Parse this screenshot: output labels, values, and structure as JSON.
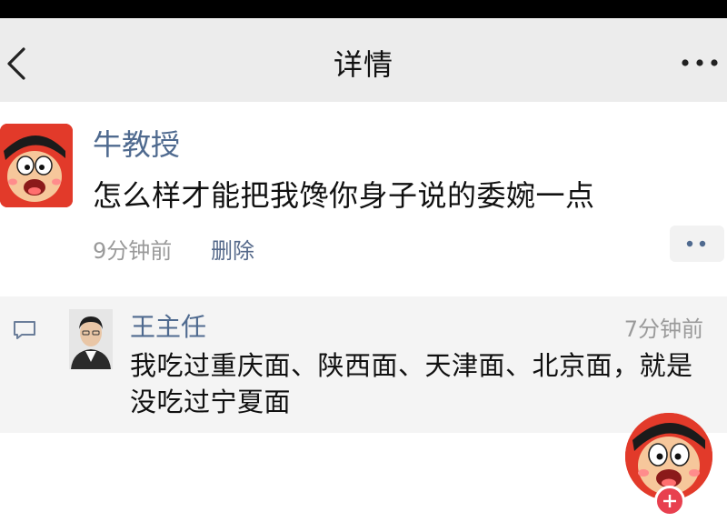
{
  "nav": {
    "title": "详情",
    "back_icon": "chevron-left-icon",
    "more_icon": "more-horizontal-icon"
  },
  "post": {
    "author": "牛教授",
    "text": "怎么样才能把我馋你身子说的委婉一点",
    "time": "9分钟前",
    "delete_label": "删除",
    "action_icon": "more-dots-icon"
  },
  "comments": [
    {
      "author": "王主任",
      "time": "7分钟前",
      "text": "我吃过重庆面、陕西面、天津面、北京面，就是没吃过宁夏面"
    }
  ],
  "fab": {
    "icon": "plus-icon"
  },
  "colors": {
    "name_link": "#4f6a8f",
    "nav_bg": "#ececec",
    "comment_bg": "#f4f4f4",
    "avatar_red": "#e23a2a",
    "fab_plus": "#e8404f"
  }
}
